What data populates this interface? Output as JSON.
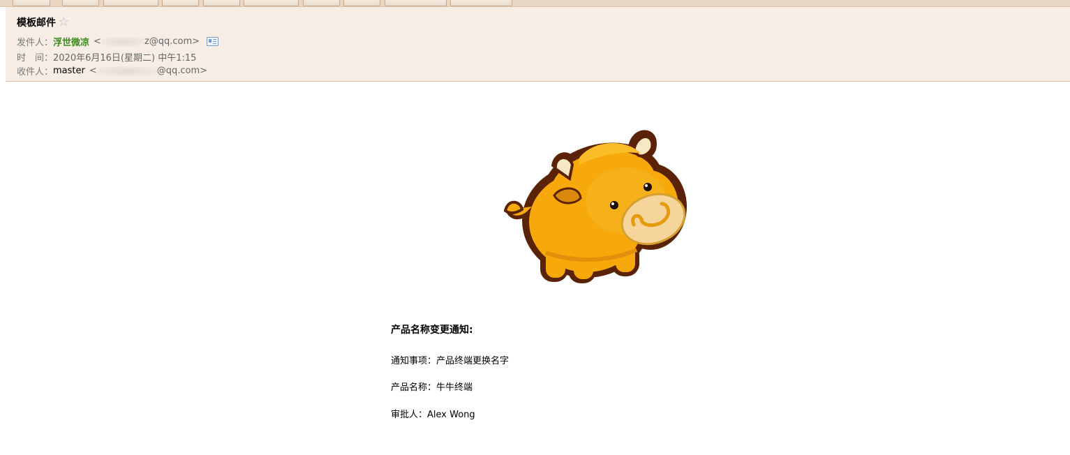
{
  "email": {
    "subject": "模板邮件",
    "from": {
      "label": "发件人：",
      "name": "浮世微凉",
      "address_open": "<",
      "address_tail": "z@qq.com>"
    },
    "time": {
      "label": "时　间：",
      "value": "2020年6月16日(星期二) 中午1:15"
    },
    "to": {
      "label": "收件人：",
      "name": "master",
      "address_open": "<",
      "address_tail": "@qq.com>"
    }
  },
  "notice": {
    "title": "产品名称变更通知:",
    "lines": [
      "通知事项：产品终端更换名字",
      "产品名称：牛牛终端",
      "审批人：Alex Wong"
    ]
  },
  "icons": {
    "star": "star-outline-icon",
    "vcard": "contact-card-icon"
  },
  "colors": {
    "header_bg": "#f7ede4",
    "toolbar_bg": "#e9d6c2",
    "sender_name": "#3a8b1f",
    "mascot_body": "#f7a90c",
    "mascot_outline": "#5a2206"
  }
}
